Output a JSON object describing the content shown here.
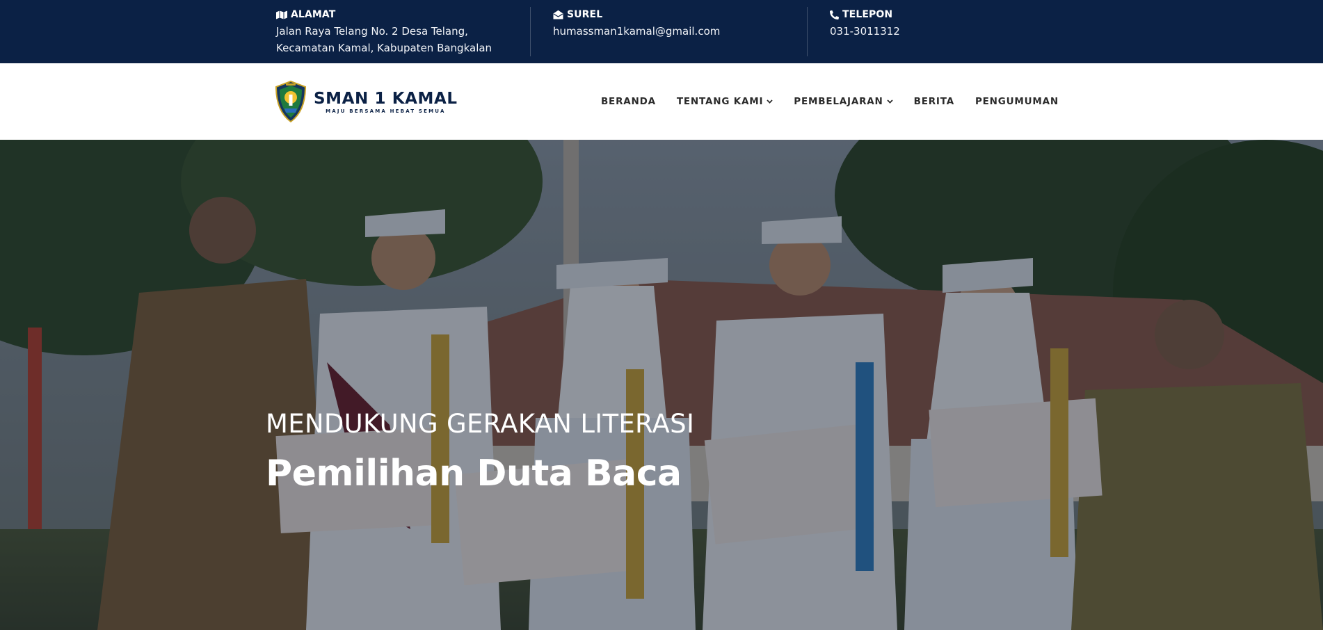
{
  "topbar": {
    "address": {
      "icon": "map-icon",
      "label": "ALAMAT",
      "lines": [
        "Jalan Raya Telang No. 2 Desa Telang,",
        "Kecamatan Kamal, Kabupaten Bangkalan"
      ]
    },
    "email": {
      "icon": "envelope-open-icon",
      "label": "SUREL",
      "value": "humassman1kamal@gmail.com"
    },
    "phone": {
      "icon": "phone-icon",
      "label": "TELEPON",
      "value": "031-3011312"
    }
  },
  "brand": {
    "name": "SMAN 1 KAMAL",
    "tagline": "MAJU BERSAMA HEBAT SEMUA"
  },
  "nav": {
    "items": [
      {
        "label": "BERANDA",
        "has_dropdown": false
      },
      {
        "label": "TENTANG KAMI",
        "has_dropdown": true
      },
      {
        "label": "PEMBELAJARAN",
        "has_dropdown": true
      },
      {
        "label": "BERITA",
        "has_dropdown": false
      },
      {
        "label": "PENGUMUMAN",
        "has_dropdown": false
      }
    ],
    "dropdown_glyph": "❯"
  },
  "hero": {
    "subtitle": "MENDUKUNG GERAKAN LITERASI",
    "title": "Pemilihan Duta Baca",
    "image_subject": "photo-students-with-trophies-and-certificates"
  },
  "colors": {
    "topbar_bg": "#0b2145",
    "brand_text": "#0b2145",
    "nav_text": "#2b2b2b",
    "hero_text": "#ffffff"
  }
}
